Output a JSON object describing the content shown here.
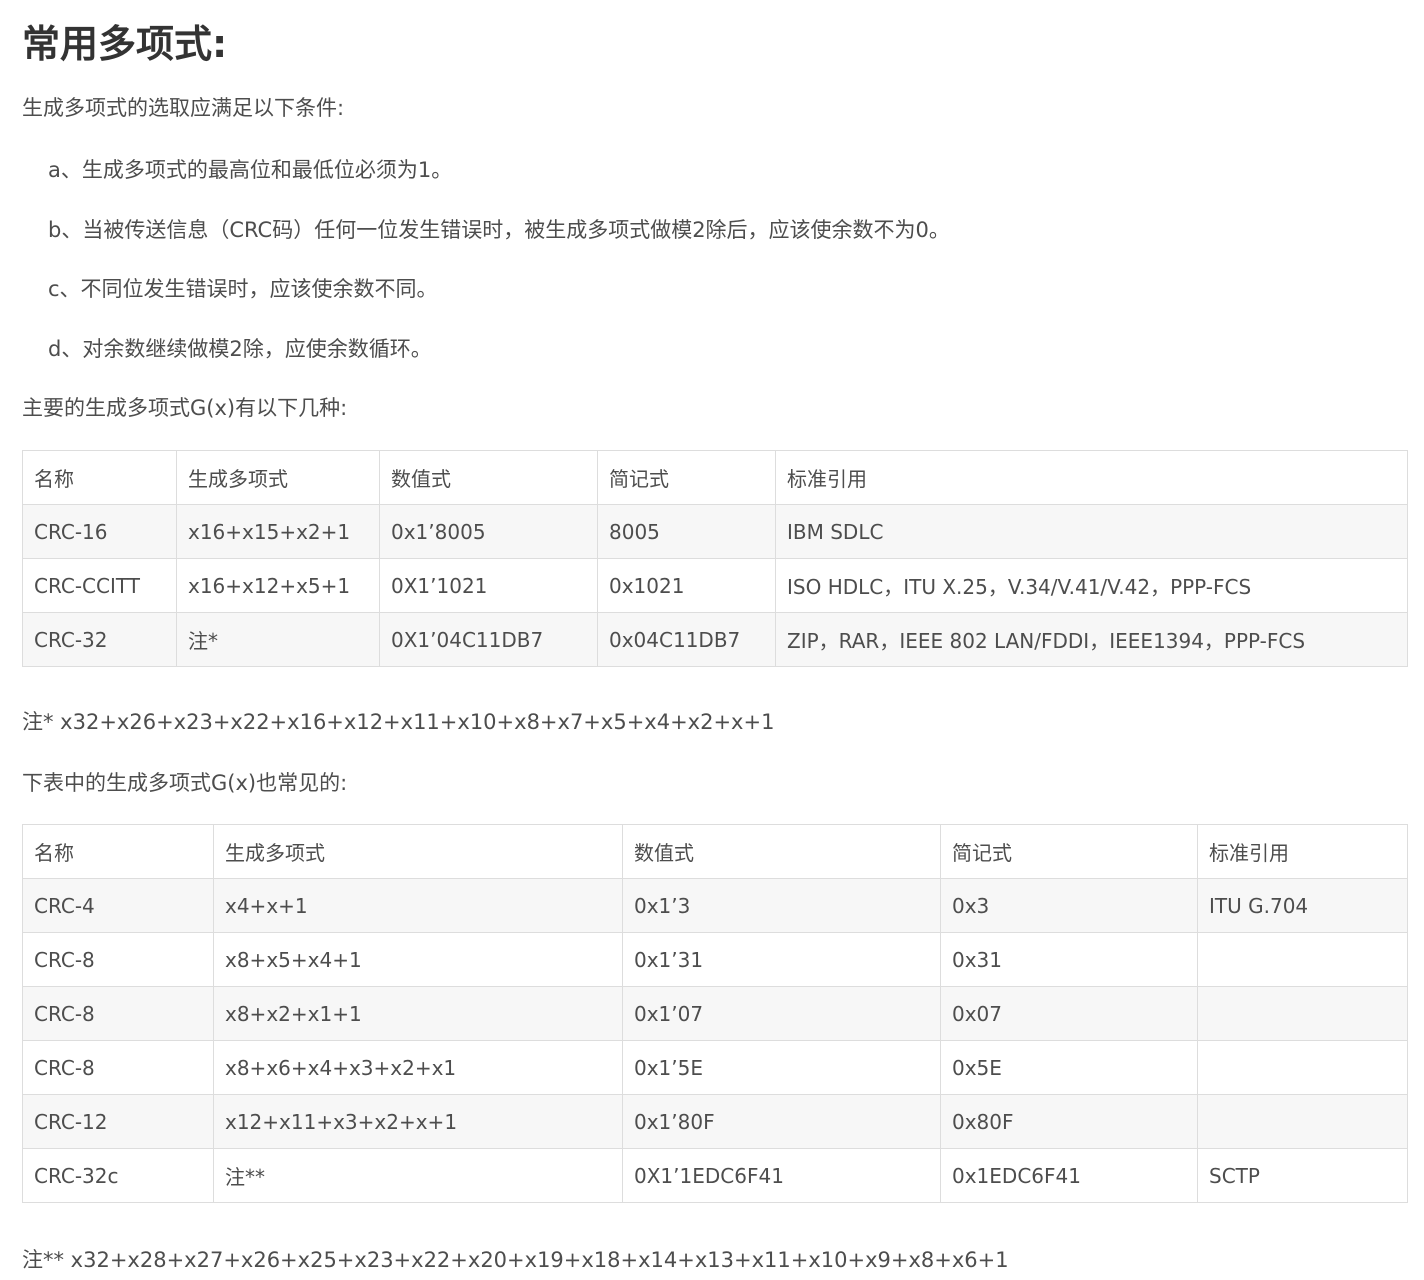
{
  "title": "常用多项式:",
  "intro": "生成多项式的选取应满足以下条件:",
  "conditions": [
    "a、生成多项式的最高位和最低位必须为1。",
    "b、当被传送信息（CRC码）任何一位发生错误时，被生成多项式做模2除后，应该使余数不为0。",
    "c、不同位发生错误时，应该使余数不同。",
    "d、对余数继续做模2除，应使余数循环。"
  ],
  "table1_caption": "主要的生成多项式G(x)有以下几种:",
  "table1": {
    "headers": [
      "名称",
      "生成多项式",
      "数值式",
      "简记式",
      "标准引用"
    ],
    "rows": [
      [
        "CRC-16",
        "x16+x15+x2+1",
        "0x1’8005",
        "8005",
        "IBM SDLC"
      ],
      [
        "CRC-CCITT",
        "x16+x12+x5+1",
        "0X1’1021",
        "0x1021",
        "ISO HDLC，ITU X.25，V.34/V.41/V.42，PPP-FCS"
      ],
      [
        "CRC-32",
        "注*",
        "0X1’04C11DB7",
        "0x04C11DB7",
        "ZIP，RAR，IEEE 802 LAN/FDDI，IEEE1394，PPP-FCS"
      ]
    ]
  },
  "note1": "注* x32+x26+x23+x22+x16+x12+x11+x10+x8+x7+x5+x4+x2+x+1",
  "table2_caption": "下表中的生成多项式G(x)也常见的:",
  "table2": {
    "headers": [
      "名称",
      "生成多项式",
      "数值式",
      "简记式",
      "标准引用"
    ],
    "rows": [
      [
        "CRC-4",
        "x4+x+1",
        "0x1’3",
        "0x3",
        "ITU G.704"
      ],
      [
        "CRC-8",
        "x8+x5+x4+1",
        "0x1’31",
        "0x31",
        ""
      ],
      [
        "CRC-8",
        "x8+x2+x1+1",
        "0x1’07",
        "0x07",
        ""
      ],
      [
        "CRC-8",
        "x8+x6+x4+x3+x2+x1",
        "0x1’5E",
        "0x5E",
        ""
      ],
      [
        "CRC-12",
        "x12+x11+x3+x2+x+1",
        "0x1’80F",
        "0x80F",
        ""
      ],
      [
        "CRC-32c",
        "注**",
        "0X1’1EDC6F41",
        "0x1EDC6F41",
        "SCTP"
      ]
    ]
  },
  "note2": "注** x32+x28+x27+x26+x25+x23+x22+x20+x19+x18+x14+x13+x11+x10+x9+x8+x6+1"
}
